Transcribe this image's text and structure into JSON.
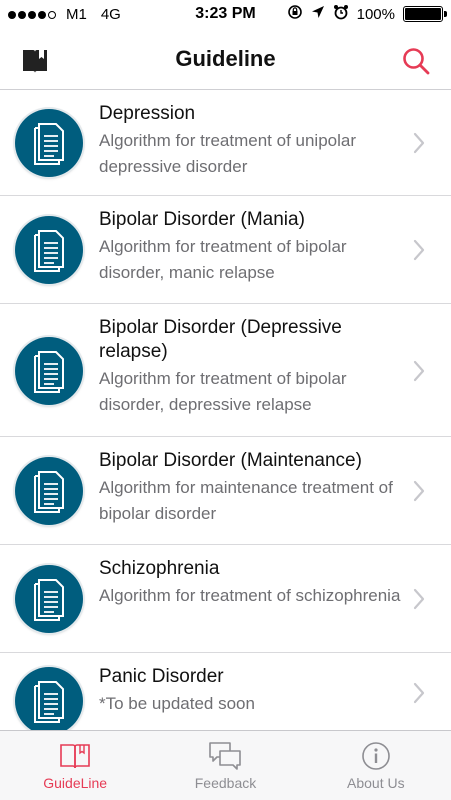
{
  "status_bar": {
    "carrier": "M1",
    "network": "4G",
    "time": "3:23 PM",
    "battery_percent": "100%",
    "battery_level": 1.0,
    "signal_bars_filled": 4,
    "signal_bars_total": 5
  },
  "nav": {
    "title": "Guideline",
    "left_icon": "book-icon",
    "right_icon": "search-icon",
    "accent_color": "#e63b55"
  },
  "list": {
    "icon": "document-icon",
    "icon_color": "#005d7e",
    "items": [
      {
        "title": "Depression",
        "subtitle": "Algorithm for treatment of unipolar depressive disorder"
      },
      {
        "title": "Bipolar Disorder (Mania)",
        "subtitle": "Algorithm for treatment of bipolar disorder, manic relapse"
      },
      {
        "title": "Bipolar Disorder (Depressive relapse)",
        "subtitle": "Algorithm for treatment of bipolar disorder, depressive relapse"
      },
      {
        "title": "Bipolar Disorder (Maintenance)",
        "subtitle": "Algorithm for maintenance treatment of bipolar disorder"
      },
      {
        "title": "Schizophrenia",
        "subtitle": "Algorithm for treatment of schizophrenia"
      },
      {
        "title": "Panic Disorder",
        "subtitle": "*To be updated soon"
      }
    ]
  },
  "tab_bar": {
    "tabs": [
      {
        "label": "GuideLine",
        "icon": "book-icon",
        "active": true
      },
      {
        "label": "Feedback",
        "icon": "chat-bubbles-icon",
        "active": false
      },
      {
        "label": "About Us",
        "icon": "info-icon",
        "active": false
      }
    ]
  }
}
